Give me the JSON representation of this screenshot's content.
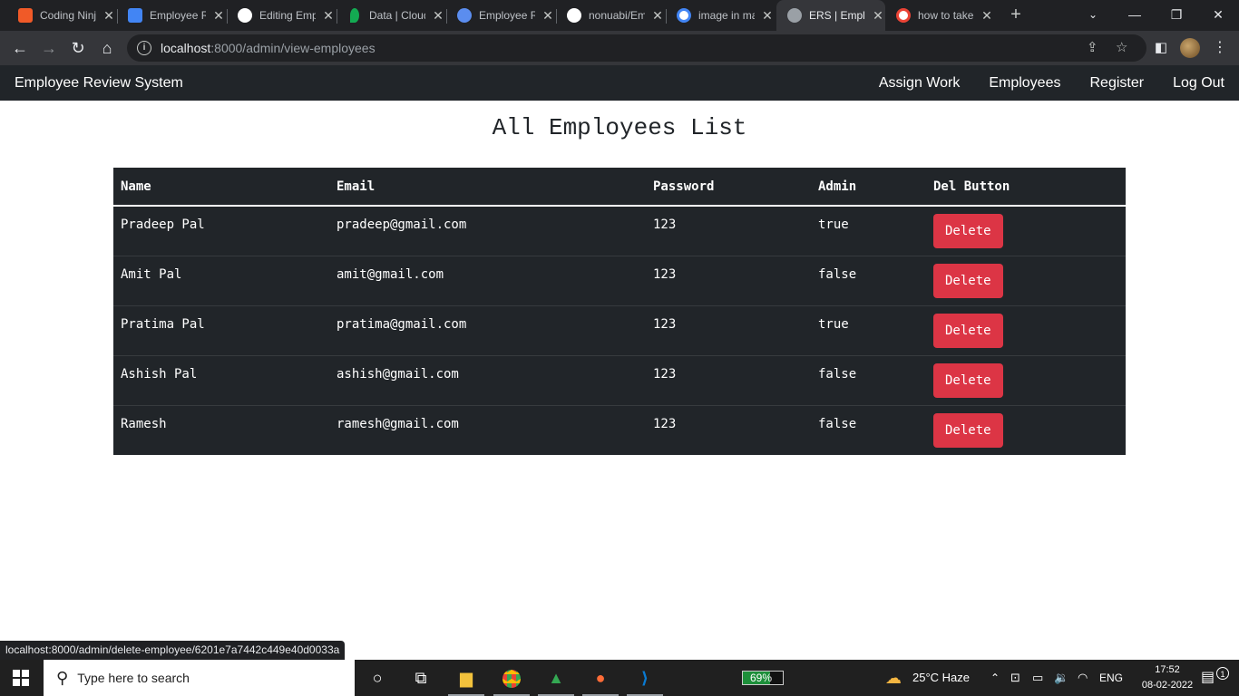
{
  "browser": {
    "tabs": [
      {
        "title": "Coding Ninjas",
        "favicon": "coding-ninjas-icon",
        "color": "#f05a28"
      },
      {
        "title": "Employee Review",
        "favicon": "google-docs-icon",
        "color": "#4285f4"
      },
      {
        "title": "Editing Employee",
        "favicon": "github-icon",
        "color": "#ffffff"
      },
      {
        "title": "Data | Cloud",
        "favicon": "mongodb-leaf-icon",
        "color": "#13aa52"
      },
      {
        "title": "Employee Review",
        "favicon": "app-icon",
        "color": "#5b8def"
      },
      {
        "title": "nonuabi/Employee",
        "favicon": "github-icon",
        "color": "#ffffff"
      },
      {
        "title": "image in markdown",
        "favicon": "google-icon",
        "color": "#ffffff"
      },
      {
        "title": "ERS | Employees",
        "favicon": "globe-icon",
        "color": "#9aa0a6"
      },
      {
        "title": "how to take",
        "favicon": "google-icon",
        "color": "#ffffff"
      }
    ],
    "active_tab": 7,
    "url_host": "localhost",
    "url_path": ":8000/admin/view-employees",
    "status_url": "localhost:8000/admin/delete-employee/6201e7a7442c449e40d0033a"
  },
  "app": {
    "brand": "Employee Review System",
    "nav": [
      "Assign Work",
      "Employees",
      "Register",
      "Log Out"
    ],
    "page_title": "All Employees List",
    "table": {
      "headers": [
        "Name",
        "Email",
        "Password",
        "Admin",
        "Del Button"
      ],
      "rows": [
        {
          "name": "Pradeep Pal",
          "email": "pradeep@gmail.com",
          "password": "123",
          "admin": "true",
          "action": "Delete"
        },
        {
          "name": "Amit Pal",
          "email": "amit@gmail.com",
          "password": "123",
          "admin": "false",
          "action": "Delete"
        },
        {
          "name": "Pratima Pal",
          "email": "pratima@gmail.com",
          "password": "123",
          "admin": "true",
          "action": "Delete"
        },
        {
          "name": "Ashish Pal",
          "email": "ashish@gmail.com",
          "password": "123",
          "admin": "false",
          "action": "Delete"
        },
        {
          "name": "Ramesh",
          "email": "ramesh@gmail.com",
          "password": "123",
          "admin": "false",
          "action": "Delete"
        }
      ]
    }
  },
  "taskbar": {
    "search_placeholder": "Type here to search",
    "battery": "69%",
    "battery_fraction": 0.69,
    "weather": "25°C  Haze",
    "language": "ENG",
    "time": "17:52",
    "date": "08-02-2022",
    "notification_count": "1"
  },
  "colors": {
    "navbar_bg": "#212529",
    "danger": "#dc3545",
    "chrome_dark": "#202124",
    "chrome_toolbar": "#35363a"
  }
}
